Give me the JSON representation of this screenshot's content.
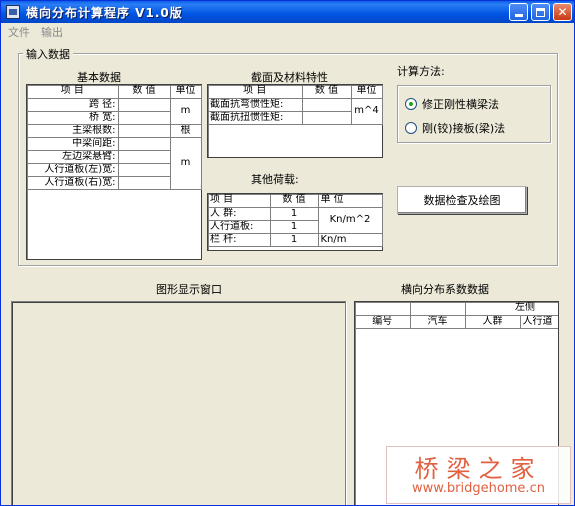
{
  "window": {
    "title": "横向分布计算程序  V1.0版"
  },
  "menu": {
    "file": "文件",
    "output": "输出"
  },
  "input_group": {
    "legend": "输入数据"
  },
  "basic": {
    "title": "基本数据",
    "headers": [
      "项    目",
      "数  值",
      "单位"
    ],
    "rows": [
      "跨    径:",
      "桥    宽:",
      "主梁根数:",
      "中梁间距:",
      "左边梁悬臂:",
      "人行道板(左)宽:",
      "人行道板(右)宽:"
    ],
    "unit_m1": "m",
    "unit_gen": "根",
    "unit_m2": "m"
  },
  "section": {
    "title": "截面及材料特性",
    "headers": [
      "项    目",
      "数  值",
      "单位"
    ],
    "rows": [
      "截面抗弯惯性矩:",
      "截面抗扭惯性矩:"
    ],
    "unit": "m^4"
  },
  "other": {
    "title": "其他荷载:",
    "headers": [
      "项  目",
      "数  值",
      "单  位"
    ],
    "rows": [
      {
        "name": "人    群:",
        "value": "1"
      },
      {
        "name": "人行道板:",
        "value": "1"
      },
      {
        "name": "栏    杆:",
        "value": "1"
      }
    ],
    "unit_crowd": "Kn/m^2",
    "unit_rail": "Kn/m"
  },
  "method": {
    "title": "计算方法:",
    "option1": "修正刚性横梁法",
    "option2": "刚(铰)接板(梁)法",
    "selected": 1
  },
  "check_button": "数据检查及绘图",
  "graphics": {
    "title": "图形显示窗口"
  },
  "coef": {
    "title": "横向分布系数数据",
    "group_header": "左侧",
    "headers": [
      "编号",
      "汽车",
      "人群",
      "人行道"
    ]
  },
  "watermark": {
    "main": "桥梁之家",
    "url": "www.bridgehome.cn"
  },
  "colors": {
    "title_bar": "#0054e3",
    "window_bg": "#ece9d8",
    "radio_dot": "#21a121",
    "watermark": "#e06040"
  }
}
